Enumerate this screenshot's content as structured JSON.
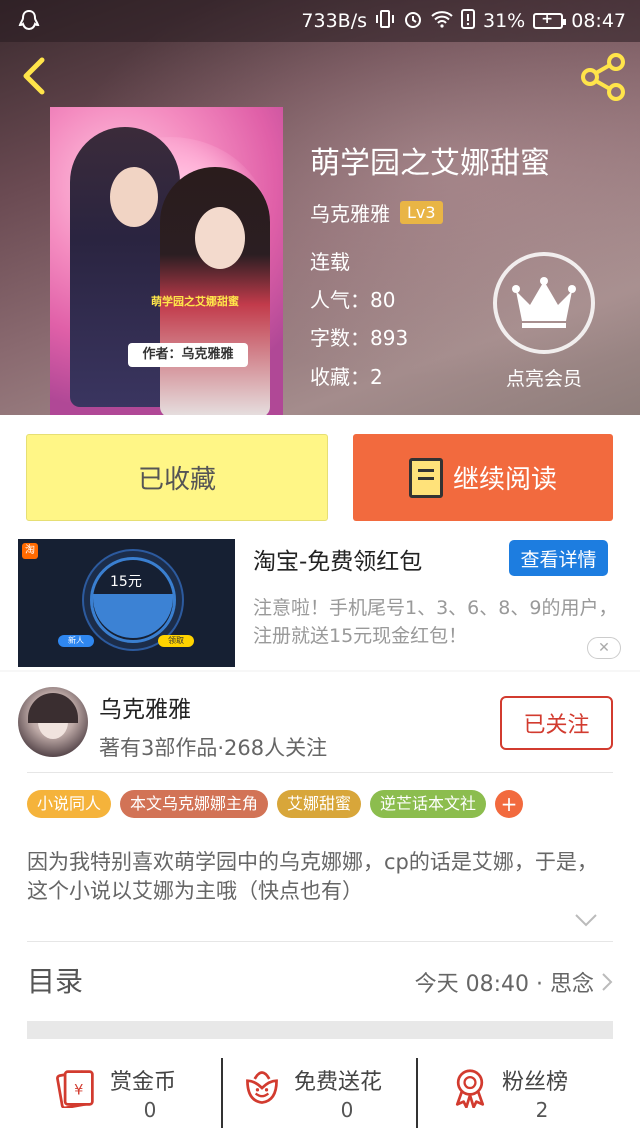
{
  "status_bar": {
    "speed": "733B/s",
    "battery": "31%",
    "time": "08:47"
  },
  "book": {
    "title": "萌学园之艾娜甜蜜",
    "author": "乌克雅雅",
    "level": "Lv3",
    "status": "连载",
    "popularity": "人气：80",
    "word_count": "字数：893",
    "favorites": "收藏：2",
    "vip_label": "点亮会员",
    "cover_caption": "萌学园之艾娜甜蜜",
    "cover_author": "作者：乌克雅雅"
  },
  "actions": {
    "favorited_label": "已收藏",
    "continue_label": "继续阅读"
  },
  "ad": {
    "title": "淘宝-免费领红包",
    "button": "查看详情",
    "description": "注意啦！手机尾号1、3、6、8、9的用户，注册就送15元现金红包！",
    "close": "✕",
    "image_amount": "15元",
    "image_btn_left": "新人",
    "image_btn_right": "领取",
    "logo": "淘"
  },
  "author_card": {
    "name": "乌克雅雅",
    "works": "著有3部作品·268人关注",
    "follow_label": "已关注"
  },
  "tags": [
    {
      "label": "小说同人",
      "color": "#f5b33b"
    },
    {
      "label": "本文乌克娜娜主角",
      "color": "#d27356"
    },
    {
      "label": "艾娜甜蜜",
      "color": "#d8a63a"
    },
    {
      "label": "逆芒话本文社",
      "color": "#8cbd4e"
    }
  ],
  "tag_add": "+",
  "synopsis": "因为我特别喜欢萌学园中的乌克娜娜，cp的话是艾娜，于是，这个小说以艾娜为主哦（快点也有）",
  "toc": {
    "label": "目录",
    "latest": "今天 08:40 · 思念"
  },
  "bottom_bar": [
    {
      "label": "赏金币",
      "count": "0",
      "icon": "red-envelope-icon"
    },
    {
      "label": "免费送花",
      "count": "0",
      "icon": "flower-icon"
    },
    {
      "label": "粉丝榜",
      "count": "2",
      "icon": "medal-icon"
    }
  ],
  "colors": {
    "accent": "#f26a3e",
    "fav_button": "#fff686",
    "ad_button": "#1d7de0",
    "follow": "#d23b2f",
    "level_badge": "#e9b545"
  }
}
